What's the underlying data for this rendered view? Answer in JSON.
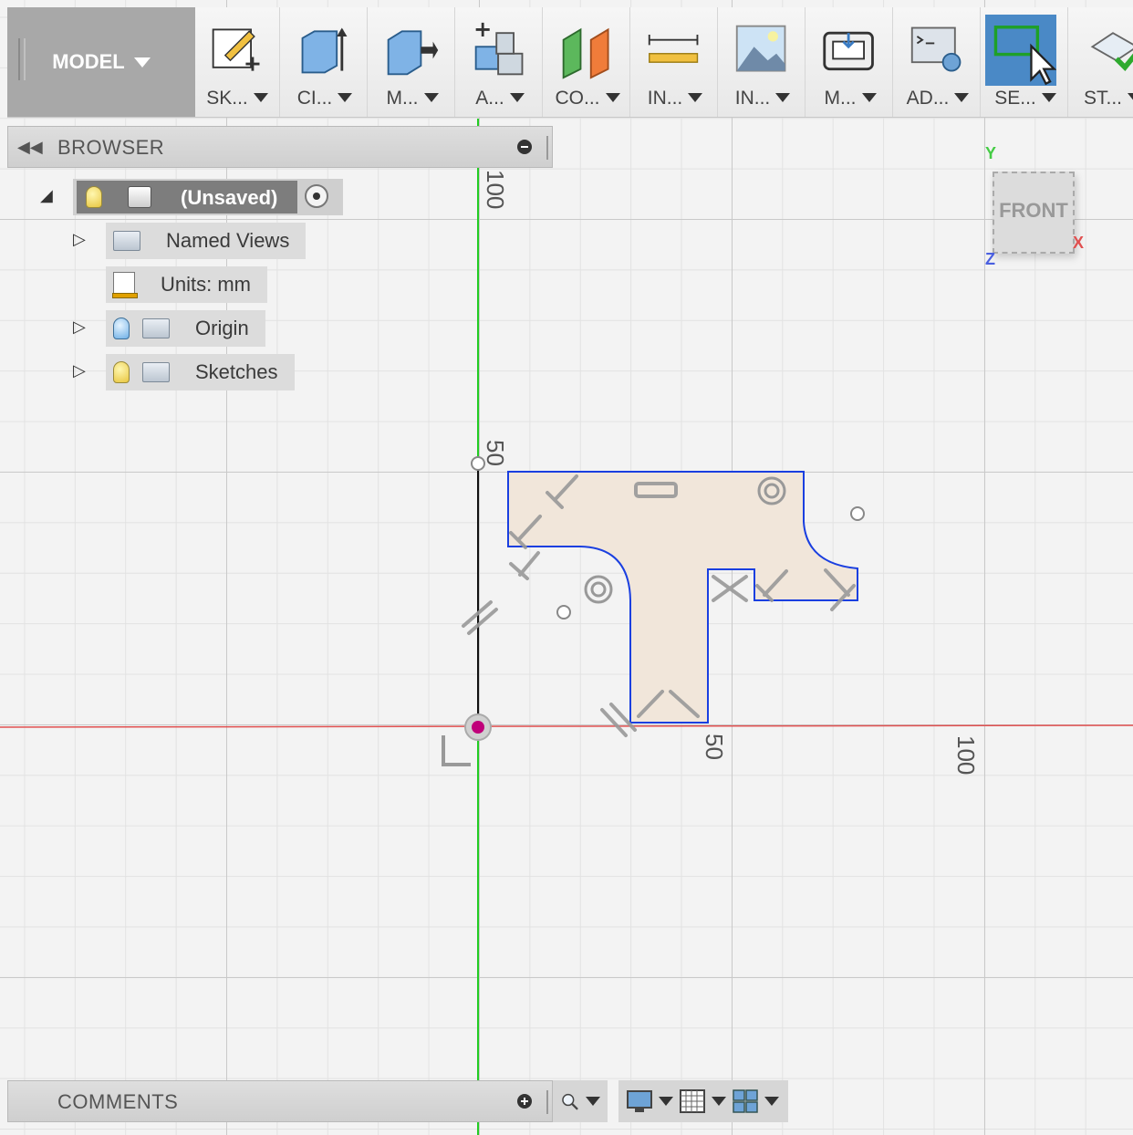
{
  "toolbar": {
    "workspace_label": "MODEL",
    "groups": [
      {
        "label": "SK...",
        "icon": "sketch-icon"
      },
      {
        "label": "CI...",
        "icon": "create-icon"
      },
      {
        "label": "M...",
        "icon": "modify-icon"
      },
      {
        "label": "A...",
        "icon": "assemble-icon"
      },
      {
        "label": "CO...",
        "icon": "construct-icon"
      },
      {
        "label": "IN...",
        "icon": "inspect-icon"
      },
      {
        "label": "IN...",
        "icon": "insert-icon"
      },
      {
        "label": "M...",
        "icon": "make-icon"
      },
      {
        "label": "AD...",
        "icon": "addins-icon"
      },
      {
        "label": "SE...",
        "icon": "select-icon"
      },
      {
        "label": "ST...",
        "icon": "stop-sketch-icon"
      }
    ],
    "active_group_index": 9
  },
  "browser": {
    "title": "BROWSER",
    "root": {
      "label": "(Unsaved)"
    },
    "items": [
      {
        "label": "Named Views",
        "has_bulb": false,
        "expandable": true
      },
      {
        "label": "Units: mm",
        "has_bulb": false,
        "expandable": false
      },
      {
        "label": "Origin",
        "has_bulb": true,
        "bulb_color": "blue",
        "expandable": true
      },
      {
        "label": "Sketches",
        "has_bulb": true,
        "bulb_color": "yellow",
        "expandable": true
      }
    ]
  },
  "viewcube": {
    "face": "FRONT",
    "axis_y": "Y",
    "axis_x": "X",
    "axis_z": "Z"
  },
  "ruler_labels": {
    "vertical_100": "100",
    "vertical_50": "50",
    "horizontal_50": "50",
    "horizontal_100": "100"
  },
  "comments": {
    "title": "COMMENTS"
  },
  "colors": {
    "y_axis": "#22cc22",
    "x_axis": "#e05050",
    "profile_fill": "#f1e6da",
    "profile_stroke": "#1a3fe0",
    "active_tool": "#4a89c6"
  }
}
